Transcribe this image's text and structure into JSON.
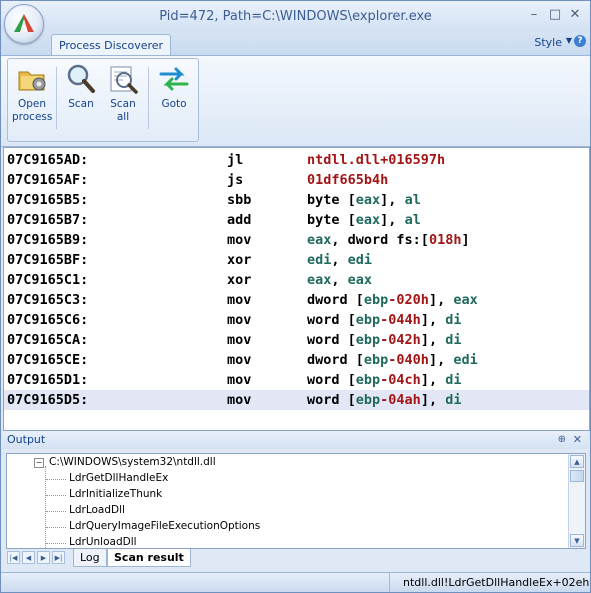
{
  "window": {
    "title": "Pid=472, Path=C:\\WINDOWS\\explorer.exe",
    "controls": {
      "minimize": "–",
      "maximize": "□",
      "close": "✕"
    }
  },
  "ribbon": {
    "tab": "Process Discoverer",
    "style_menu": "Style",
    "help": "?",
    "buttons": [
      {
        "label": "Open\nprocess",
        "icon": "open-folder-gear-icon"
      },
      {
        "label": "Scan",
        "icon": "magnifier-icon"
      },
      {
        "label": "Scan\nall",
        "icon": "scan-document-icon"
      },
      {
        "label": "Goto",
        "icon": "swap-arrows-icon"
      }
    ]
  },
  "disassembly": [
    {
      "addr": "07C9165AD:",
      "mnemonic": "jl",
      "operands": [
        {
          "t": "ntdll.dll+016597h",
          "c": "red"
        }
      ]
    },
    {
      "addr": "07C9165AF:",
      "mnemonic": "js",
      "operands": [
        {
          "t": "01df665b4h",
          "c": "red"
        }
      ]
    },
    {
      "addr": "07C9165B5:",
      "mnemonic": "sbb",
      "operands": [
        {
          "t": "byte [",
          "c": ""
        },
        {
          "t": "eax",
          "c": "grn"
        },
        {
          "t": "], ",
          "c": ""
        },
        {
          "t": "al",
          "c": "grn"
        }
      ]
    },
    {
      "addr": "07C9165B7:",
      "mnemonic": "add",
      "operands": [
        {
          "t": "byte [",
          "c": ""
        },
        {
          "t": "eax",
          "c": "grn"
        },
        {
          "t": "], ",
          "c": ""
        },
        {
          "t": "al",
          "c": "grn"
        }
      ]
    },
    {
      "addr": "07C9165B9:",
      "mnemonic": "mov",
      "operands": [
        {
          "t": "eax",
          "c": "grn"
        },
        {
          "t": ", dword fs:[",
          "c": ""
        },
        {
          "t": "018h",
          "c": "red"
        },
        {
          "t": "]",
          "c": ""
        }
      ]
    },
    {
      "addr": "07C9165BF:",
      "mnemonic": "xor",
      "operands": [
        {
          "t": "edi",
          "c": "grn"
        },
        {
          "t": ", ",
          "c": ""
        },
        {
          "t": "edi",
          "c": "grn"
        }
      ]
    },
    {
      "addr": "07C9165C1:",
      "mnemonic": "xor",
      "operands": [
        {
          "t": "eax",
          "c": "grn"
        },
        {
          "t": ", ",
          "c": ""
        },
        {
          "t": "eax",
          "c": "grn"
        }
      ]
    },
    {
      "addr": "07C9165C3:",
      "mnemonic": "mov",
      "operands": [
        {
          "t": "dword [",
          "c": ""
        },
        {
          "t": "ebp",
          "c": "grn"
        },
        {
          "t": "-020h",
          "c": "red"
        },
        {
          "t": "], ",
          "c": ""
        },
        {
          "t": "eax",
          "c": "grn"
        }
      ]
    },
    {
      "addr": "07C9165C6:",
      "mnemonic": "mov",
      "operands": [
        {
          "t": "word [",
          "c": ""
        },
        {
          "t": "ebp",
          "c": "grn"
        },
        {
          "t": "-044h",
          "c": "red"
        },
        {
          "t": "], ",
          "c": ""
        },
        {
          "t": "di",
          "c": "grn"
        }
      ]
    },
    {
      "addr": "07C9165CA:",
      "mnemonic": "mov",
      "operands": [
        {
          "t": "word [",
          "c": ""
        },
        {
          "t": "ebp",
          "c": "grn"
        },
        {
          "t": "-042h",
          "c": "red"
        },
        {
          "t": "], ",
          "c": ""
        },
        {
          "t": "di",
          "c": "grn"
        }
      ]
    },
    {
      "addr": "07C9165CE:",
      "mnemonic": "mov",
      "operands": [
        {
          "t": "dword [",
          "c": ""
        },
        {
          "t": "ebp",
          "c": "grn"
        },
        {
          "t": "-040h",
          "c": "red"
        },
        {
          "t": "], ",
          "c": ""
        },
        {
          "t": "edi",
          "c": "grn"
        }
      ]
    },
    {
      "addr": "07C9165D1:",
      "mnemonic": "mov",
      "operands": [
        {
          "t": "word [",
          "c": ""
        },
        {
          "t": "ebp",
          "c": "grn"
        },
        {
          "t": "-04ch",
          "c": "red"
        },
        {
          "t": "], ",
          "c": ""
        },
        {
          "t": "di",
          "c": "grn"
        }
      ]
    },
    {
      "addr": "07C9165D5:",
      "mnemonic": "mov",
      "operands": [
        {
          "t": "word [",
          "c": ""
        },
        {
          "t": "ebp",
          "c": "grn"
        },
        {
          "t": "-04ah",
          "c": "red"
        },
        {
          "t": "], ",
          "c": ""
        },
        {
          "t": "di",
          "c": "grn"
        }
      ],
      "selected": true
    }
  ],
  "output": {
    "title": "Output",
    "pin": "⊕",
    "close": "✕",
    "root": "C:\\WINDOWS\\system32\\ntdll.dll",
    "expander": "−",
    "children": [
      "LdrGetDllHandleEx",
      "LdrInitializeThunk",
      "LdrLoadDll",
      "LdrQueryImageFileExecutionOptions",
      "LdrUnloadDll"
    ]
  },
  "bottom_tabs": {
    "log": "Log",
    "scan_result": "Scan result"
  },
  "status": {
    "location": "ntdll.dll!LdrGetDllHandleEx+02eh"
  },
  "colors": {
    "register": "#1f6a5c",
    "constant": "#a31515",
    "selection": "#e3e7f5",
    "accent": "#15428b"
  }
}
